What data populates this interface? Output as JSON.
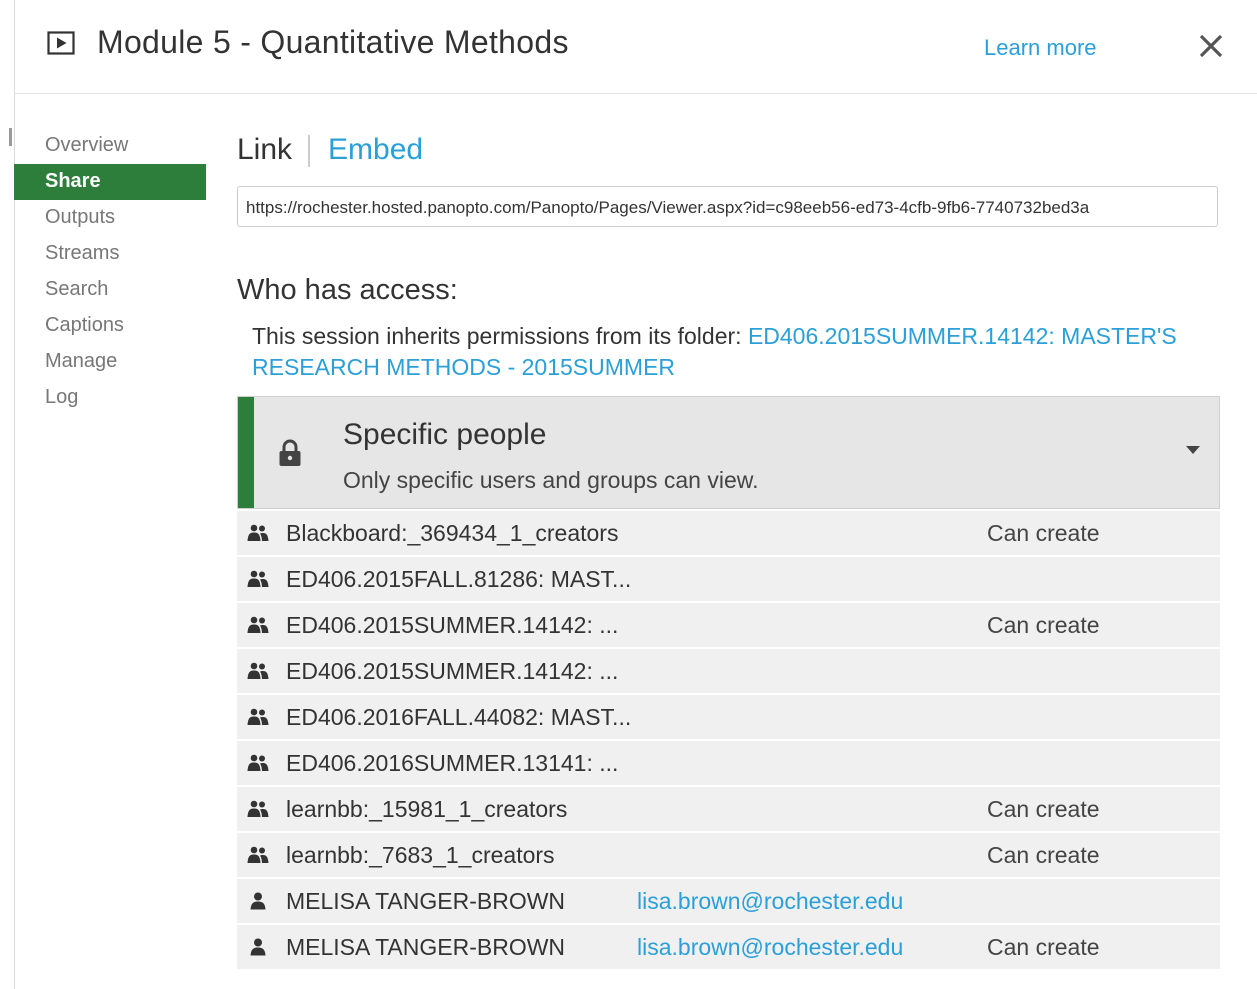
{
  "header": {
    "title": "Module 5 - Quantitative Methods",
    "learn_more": "Learn more",
    "icons": {
      "play": "play-icon",
      "close": "close-icon"
    }
  },
  "nav": {
    "items": [
      {
        "label": "Overview",
        "active": false
      },
      {
        "label": "Share",
        "active": true
      },
      {
        "label": "Outputs",
        "active": false
      },
      {
        "label": "Streams",
        "active": false
      },
      {
        "label": "Search",
        "active": false
      },
      {
        "label": "Captions",
        "active": false
      },
      {
        "label": "Manage",
        "active": false
      },
      {
        "label": "Log",
        "active": false
      }
    ]
  },
  "share": {
    "tab_link": "Link",
    "tab_embed": "Embed",
    "url": "https://rochester.hosted.panopto.com/Panopto/Pages/Viewer.aspx?id=c98eeb56-ed73-4cfb-9fb6-7740732bed3a",
    "who_has_access": "Who has access:",
    "inherit_text": "This session inherits permissions from its folder: ",
    "inherit_folder": "ED406.2015SUMMER.14142: MASTER'S RESEARCH METHODS - 2015SUMMER",
    "access_level": {
      "title": "Specific people",
      "description": "Only specific users and groups can view."
    },
    "entries": [
      {
        "type": "group",
        "name": "Blackboard:_369434_1_creators",
        "email": "",
        "permission": "Can create"
      },
      {
        "type": "group",
        "name": "ED406.2015FALL.81286: MAST...",
        "email": "",
        "permission": ""
      },
      {
        "type": "group",
        "name": "ED406.2015SUMMER.14142: ...",
        "email": "",
        "permission": "Can create"
      },
      {
        "type": "group",
        "name": "ED406.2015SUMMER.14142: ...",
        "email": "",
        "permission": ""
      },
      {
        "type": "group",
        "name": "ED406.2016FALL.44082: MAST...",
        "email": "",
        "permission": ""
      },
      {
        "type": "group",
        "name": "ED406.2016SUMMER.13141: ...",
        "email": "",
        "permission": ""
      },
      {
        "type": "group",
        "name": "learnbb:_15981_1_creators",
        "email": "",
        "permission": "Can create"
      },
      {
        "type": "group",
        "name": "learnbb:_7683_1_creators",
        "email": "",
        "permission": "Can create"
      },
      {
        "type": "user",
        "name": "MELISA TANGER-BROWN",
        "email": "lisa.brown@rochester.edu",
        "permission": ""
      },
      {
        "type": "user",
        "name": "MELISA TANGER-BROWN",
        "email": "lisa.brown@rochester.edu",
        "permission": "Can create"
      }
    ]
  },
  "colors": {
    "accent": "#2d7d3b",
    "link": "#2a9fd8"
  }
}
